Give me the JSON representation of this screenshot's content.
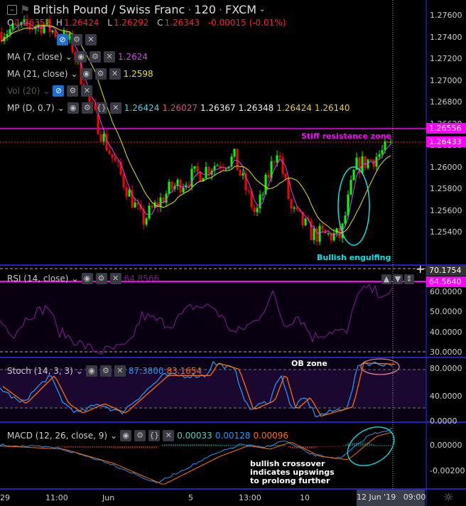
{
  "header": {
    "title": "British Pound / Swiss Franc",
    "interval": "120",
    "exchange": "FXCM",
    "ohlc": {
      "o_label": "O",
      "o": "1.26358",
      "h_label": "H",
      "h": "1.26424",
      "l_label": "L",
      "l": "1.26292",
      "c_label": "C",
      "c": "1.26343",
      "change": "-0.00015 (-0.01%)"
    }
  },
  "indicators": {
    "ma7": {
      "label": "MA (7, close)",
      "value": "1.2624"
    },
    "ma21": {
      "label": "MA (21, close)",
      "value": "1.2598"
    },
    "vol": {
      "label": "Vol (20)"
    },
    "mp": {
      "label": "MP (D, 0.7)",
      "values": [
        "1.26424",
        "1.26027",
        "1.26367",
        "1.26348",
        "1.26424",
        "1.26140"
      ]
    },
    "rsi": {
      "label": "RSI (14, close)",
      "value": "64.8566"
    },
    "stoch": {
      "label": "Stoch (14, 3, 3)",
      "k": "87.3800",
      "d": "83.1654"
    },
    "macd": {
      "label": "MACD (12, 26, close, 9)",
      "hist": "0.00033",
      "macd": "0.00128",
      "signal": "0.00096"
    }
  },
  "price_axis": [
    "1.27600",
    "1.27400",
    "1.27200",
    "1.27000",
    "1.26800",
    "1.26620",
    "1.26200",
    "1.26000",
    "1.25800",
    "1.25600",
    "1.25400"
  ],
  "price_tags": {
    "resistance": "1.26556",
    "last": "1.26433"
  },
  "rsi_axis": {
    "top": "70.1754",
    "tag": "64.5640",
    "ticks": [
      "60.0000",
      "50.0000",
      "40.0000",
      "30.0000"
    ]
  },
  "stoch_axis": [
    "80.0000",
    "40.0000",
    "0.0000"
  ],
  "macd_axis": [
    "0.00000",
    "-0.00200"
  ],
  "time_axis": [
    "29",
    "11:00",
    "Jun",
    "5",
    "13:00",
    "10"
  ],
  "time_cursor": "12 Jun '19   09:00",
  "annotations": {
    "resistance": "Stiff resistance zone",
    "engulfing": "Bullish engulfing",
    "ob": "OB zone",
    "macd": [
      "bullish crossover",
      "indicates upswings",
      "to prolong further"
    ]
  },
  "colors": {
    "up": "#00ff00",
    "down": "#ff0000",
    "resistance": "#ff00ff",
    "rsi": "#8a1a9a",
    "k": "#2196f3",
    "d": "#ff6d00"
  }
}
